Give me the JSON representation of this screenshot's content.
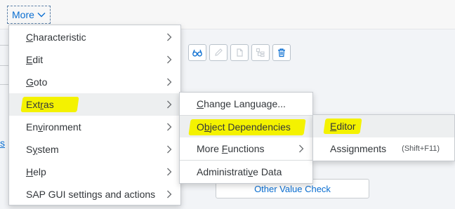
{
  "toolbar": {
    "more_label": "More",
    "buttons": [
      {
        "icon": "display-glasses-icon",
        "enabled": true
      },
      {
        "icon": "edit-pencil-icon",
        "enabled": false
      },
      {
        "icon": "copy-document-icon",
        "enabled": false
      },
      {
        "icon": "structure-tree-icon",
        "enabled": false
      },
      {
        "icon": "delete-trash-icon",
        "enabled": true
      }
    ]
  },
  "background": {
    "left_link_fragment": "s",
    "other_value_check_label": "Other Value Check"
  },
  "menu_main": {
    "items": [
      {
        "pre": "",
        "mn": "C",
        "post": "haracteristic"
      },
      {
        "pre": "",
        "mn": "E",
        "post": "dit"
      },
      {
        "pre": "",
        "mn": "G",
        "post": "oto"
      },
      {
        "pre": "Ext",
        "mn": "r",
        "post": "as"
      },
      {
        "pre": "En",
        "mn": "v",
        "post": "ironment"
      },
      {
        "pre": "S",
        "mn": "y",
        "post": "stem"
      },
      {
        "pre": "",
        "mn": "H",
        "post": "elp"
      },
      {
        "pre": "SAP GUI settings and actions",
        "mn": "",
        "post": ""
      }
    ],
    "active_index": 3
  },
  "menu_extras": {
    "items": [
      {
        "pre": "",
        "mn": "C",
        "post": "hange Language..."
      },
      {
        "pre": "O",
        "mn": "b",
        "post": "ject Dependencies"
      },
      {
        "pre": "More ",
        "mn": "F",
        "post": "unctions"
      },
      {
        "pre": "Administrati",
        "mn": "v",
        "post": "e Data"
      }
    ],
    "active_index": 1
  },
  "menu_object_dependencies": {
    "items": [
      {
        "pre": "",
        "mn": "E",
        "post": "ditor",
        "shortcut": ""
      },
      {
        "pre": "Assignments",
        "mn": "",
        "post": "",
        "shortcut": "(Shift+F11)"
      }
    ],
    "active_index": 0
  },
  "colors": {
    "highlight": "#f4f200",
    "link_blue": "#0a6ed1",
    "menu_active_bg": "#edeff0"
  }
}
